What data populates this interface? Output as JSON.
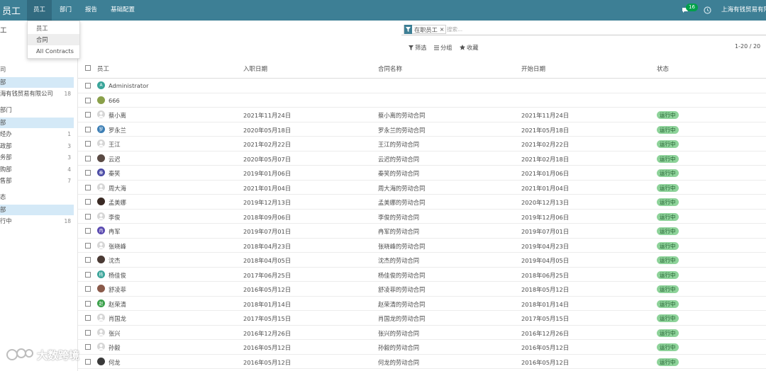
{
  "navbar": {
    "brand": "员工",
    "menus": [
      "员工",
      "部门",
      "报告",
      "基础配置"
    ],
    "active_menu": "员工",
    "message_count": "16",
    "company": "上海有钱贸易有限"
  },
  "dropdown": {
    "items": [
      "员工",
      "合同",
      "All Contracts"
    ],
    "highlighted": "合同"
  },
  "control_panel": {
    "breadcrumb": "工",
    "facet_label": "在职员工",
    "facet_close": "×",
    "search_placeholder": "搜索...",
    "filter_label": "筛选",
    "group_label": "分组",
    "favorites_label": "收藏",
    "pager": "1-20 / 20"
  },
  "left_panel": {
    "company_header": "司",
    "company_items": [
      {
        "label": "部",
        "count": "",
        "selected": true
      },
      {
        "label": "海有钱贸易有限公司",
        "count": "18",
        "selected": false
      }
    ],
    "department_header": "部门",
    "department_items": [
      {
        "label": "部",
        "count": "",
        "selected": true
      },
      {
        "label": "经办",
        "count": "1",
        "selected": false
      },
      {
        "label": "政部",
        "count": "3",
        "selected": false
      },
      {
        "label": "务部",
        "count": "3",
        "selected": false
      },
      {
        "label": "购部",
        "count": "4",
        "selected": false
      },
      {
        "label": "售部",
        "count": "7",
        "selected": false
      }
    ],
    "status_header": "态",
    "status_items": [
      {
        "label": "部",
        "count": "",
        "selected": true
      },
      {
        "label": "行中",
        "count": "18",
        "selected": false
      }
    ]
  },
  "table": {
    "columns": [
      "员工",
      "入职日期",
      "合同名称",
      "开始日期",
      "状态"
    ],
    "rows": [
      {
        "name": "Administrator",
        "hire": "",
        "contract": "",
        "start": "",
        "status": "",
        "avatar": "A",
        "avatar_color": "#3aa59a"
      },
      {
        "name": "666",
        "hire": "",
        "contract": "",
        "start": "",
        "status": "",
        "avatar": "",
        "avatar_color": "#8aa04a"
      },
      {
        "name": "蔡小离",
        "hire": "2021年11月24日",
        "contract": "蔡小离的劳动合同",
        "start": "2021年11月24日",
        "status": "运行中",
        "avatar": "",
        "avatar_color": "#d6d6d6"
      },
      {
        "name": "罗永兰",
        "hire": "2020年05月18日",
        "contract": "罗永兰的劳动合同",
        "start": "2021年05月18日",
        "status": "运行中",
        "avatar": "罗",
        "avatar_color": "#3d7fb5"
      },
      {
        "name": "王江",
        "hire": "2021年02月22日",
        "contract": "王江的劳动合同",
        "start": "2021年02月22日",
        "status": "运行中",
        "avatar": "",
        "avatar_color": "#d6d6d6"
      },
      {
        "name": "云迟",
        "hire": "2020年05月07日",
        "contract": "云迟的劳动合同",
        "start": "2021年02月18日",
        "status": "运行中",
        "avatar": "",
        "avatar_color": "#5a4a44"
      },
      {
        "name": "秦笑",
        "hire": "2019年01月06日",
        "contract": "秦笑的劳动合同",
        "start": "2021年01月06日",
        "status": "运行中",
        "avatar": "秦",
        "avatar_color": "#4a4aa5"
      },
      {
        "name": "周大海",
        "hire": "2021年01月04日",
        "contract": "周大海的劳动合同",
        "start": "2021年01月04日",
        "status": "运行中",
        "avatar": "",
        "avatar_color": "#d6d6d6"
      },
      {
        "name": "孟美娜",
        "hire": "2019年12月13日",
        "contract": "孟美娜的劳动合同",
        "start": "2020年12月13日",
        "status": "运行中",
        "avatar": "",
        "avatar_color": "#3a2a24"
      },
      {
        "name": "李俊",
        "hire": "2018年09月06日",
        "contract": "李俊的劳动合同",
        "start": "2019年12月06日",
        "status": "运行中",
        "avatar": "",
        "avatar_color": "#d6d6d6"
      },
      {
        "name": "冉军",
        "hire": "2019年07月01日",
        "contract": "冉军的劳动合同",
        "start": "2019年07月01日",
        "status": "运行中",
        "avatar": "冉",
        "avatar_color": "#5a4ab0"
      },
      {
        "name": "张晓峰",
        "hire": "2018年04月23日",
        "contract": "张晓峰的劳动合同",
        "start": "2019年04月23日",
        "status": "运行中",
        "avatar": "",
        "avatar_color": "#d6d6d6"
      },
      {
        "name": "沈杰",
        "hire": "2018年04月05日",
        "contract": "沈杰的劳动合同",
        "start": "2019年04月05日",
        "status": "运行中",
        "avatar": "",
        "avatar_color": "#4a3a34"
      },
      {
        "name": "杨佳俊",
        "hire": "2017年06月25日",
        "contract": "杨佳俊的劳动合同",
        "start": "2018年06月25日",
        "status": "运行中",
        "avatar": "杨",
        "avatar_color": "#3aa59a"
      },
      {
        "name": "舒凌菲",
        "hire": "2016年05月12日",
        "contract": "舒凌菲的劳动合同",
        "start": "2018年05月12日",
        "status": "运行中",
        "avatar": "",
        "avatar_color": "#8a5a4a"
      },
      {
        "name": "赵荣清",
        "hire": "2018年01月14日",
        "contract": "赵荣清的劳动合同",
        "start": "2018年01月14日",
        "status": "运行中",
        "avatar": "赵",
        "avatar_color": "#3aa04a"
      },
      {
        "name": "肖国龙",
        "hire": "2017年05月15日",
        "contract": "肖国龙的劳动合同",
        "start": "2017年05月15日",
        "status": "运行中",
        "avatar": "",
        "avatar_color": "#d6d6d6"
      },
      {
        "name": "张兴",
        "hire": "2016年12月26日",
        "contract": "张兴的劳动合同",
        "start": "2016年12月26日",
        "status": "运行中",
        "avatar": "",
        "avatar_color": "#d6d6d6"
      },
      {
        "name": "孙毅",
        "hire": "2016年05月12日",
        "contract": "孙毅的劳动合同",
        "start": "2016年05月12日",
        "status": "运行中",
        "avatar": "",
        "avatar_color": "#d6d6d6"
      },
      {
        "name": "何龙",
        "hire": "2016年05月12日",
        "contract": "何龙的劳动合同",
        "start": "2016年05月12日",
        "status": "运行中",
        "avatar": "",
        "avatar_color": "#3a3a3a"
      }
    ]
  },
  "watermark": {
    "text": "大数跨境"
  },
  "colors": {
    "navbar": "#3d7f95",
    "selected": "#d4e9f7",
    "status_bg": "#8ed39a",
    "badge": "#00a04a"
  }
}
